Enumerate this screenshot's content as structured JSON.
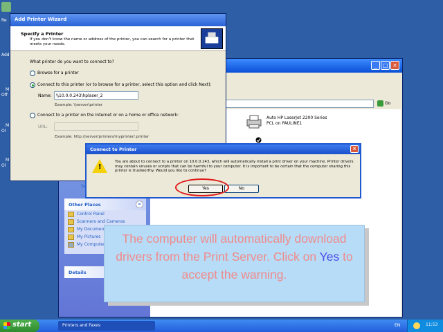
{
  "desktop": {
    "icon_labels": [
      "Re",
      "Add",
      "M",
      "Off",
      "M",
      "Ol",
      "M",
      "Ol"
    ]
  },
  "printers_window": {
    "address_go": "Go",
    "left_text": "rs",
    "printer": {
      "name": "Auto HP LaserJet 2200 Series",
      "location": "PCL on PAULINE1"
    },
    "other_places": {
      "title": "Other Places",
      "items": [
        "Control Panel",
        "Scanners and Cameras",
        "My Documents",
        "My Pictures",
        "My Computer"
      ]
    },
    "details_title": "Details",
    "see_also_fragment": "Se"
  },
  "wizard": {
    "title": "Add Printer Wizard",
    "heading": "Specify a Printer",
    "subheading": "If you don't know the name or address of the printer, you can search for a printer that meets your needs.",
    "question": "What printer do you want to connect to?",
    "option_browse": "Browse for a printer",
    "option_connect": "Connect to this printer (or to browse for a printer, select this option and click Next):",
    "name_label": "Name:",
    "name_value": "\\\\10.0.0.243\\hplaser_2",
    "name_example": "Example: \\\\server\\printer",
    "option_internet": "Connect to a printer on the Internet or on a home or office network:",
    "url_label": "URL:",
    "url_example": "Example: http://server/printers/myprinter/.printer"
  },
  "dialog": {
    "title": "Connect to Printer",
    "message": "You are about to connect to a printer on 10.0.0.243, which will automatically install a print driver on your machine. Printer drivers may contain viruses or scripts that can be harmful to your computer.  It is important to be certain that the computer sharing this printer is trustworthy.  Would you like to continue?",
    "yes_label": "Yes",
    "no_label": "No"
  },
  "callout": {
    "text_before": "The computer will automatically download drivers from the Print Server. Click on ",
    "highlight": "Yes",
    "text_after": " to accept the warning."
  },
  "taskbar": {
    "start_label": "start",
    "task_label": "Printers and Faxes",
    "language": "EN",
    "clock": "11:53"
  }
}
